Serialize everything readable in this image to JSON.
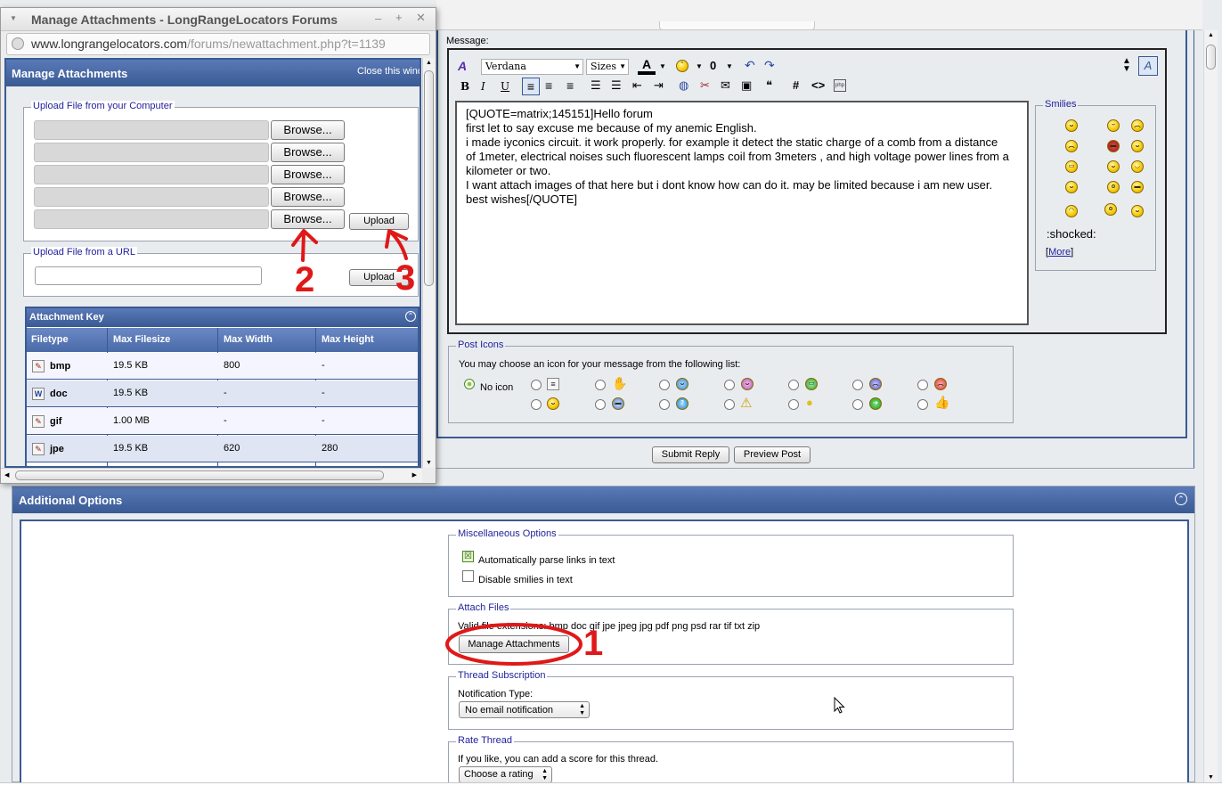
{
  "popup": {
    "window_title": "Manage Attachments - LongRangeLocators Forums",
    "url_host": "www.longrangelocators.com",
    "url_path": "/forums/newattachment.php?t=1139",
    "panel_title": "Manage Attachments",
    "close_link": "Close this wind",
    "upload_computer_legend": "Upload File from your Computer",
    "browse_label": "Browse...",
    "upload_label": "Upload",
    "upload_url_legend": "Upload File from a URL",
    "attachment_key_title": "Attachment Key",
    "columns": [
      "Filetype",
      "Max Filesize",
      "Max Width",
      "Max Height"
    ],
    "rows": [
      {
        "type": "bmp",
        "size": "19.5 KB",
        "width": "800",
        "height": "-"
      },
      {
        "type": "doc",
        "size": "19.5 KB",
        "width": "-",
        "height": "-"
      },
      {
        "type": "gif",
        "size": "1.00 MB",
        "width": "-",
        "height": "-"
      },
      {
        "type": "jpe",
        "size": "19.5 KB",
        "width": "620",
        "height": "280"
      }
    ]
  },
  "editor": {
    "message_label": "Message:",
    "font_name": "Verdana",
    "font_size": "Sizes",
    "text_lines": [
      "[QUOTE=matrix;145151]Hello forum",
      "first let to say excuse me because of my anemic English.",
      "i made iyconics circuit. it work properly. for example it detect the static charge of a comb from a distance",
      "of 1meter, electrical noises such fluorescent lamps coil from 3meters , and high voltage power lines from a",
      "kilometer or two.",
      "I want attach images of that here but i dont know how can do it. may be limited because i am new user.",
      "best wishes[/QUOTE]"
    ],
    "smilies_legend": "Smilies",
    "smilie_label": ":shocked:",
    "more_link": "More"
  },
  "post_icons": {
    "legend": "Post Icons",
    "instruction": "You may choose an icon for your message from the following list:",
    "no_icon_label": "No icon"
  },
  "buttons": {
    "submit": "Submit Reply",
    "preview": "Preview Post"
  },
  "additional": {
    "title": "Additional Options",
    "misc_legend": "Miscellaneous Options",
    "parse_links": "Automatically parse links in text",
    "parse_links_checked": true,
    "disable_smilies": "Disable smilies in text",
    "disable_smilies_checked": false,
    "attach_legend": "Attach Files",
    "valid_ext": "Valid file extensions: bmp doc gif jpe jpeg jpg pdf png psd rar tif txt zip",
    "manage_btn": "Manage Attachments",
    "subscription_legend": "Thread Subscription",
    "notification_label": "Notification Type:",
    "notification_value": "No email notification",
    "rate_legend": "Rate Thread",
    "rate_text": "If you like, you can add a score for this thread.",
    "rate_value": "Choose a rating"
  },
  "annotations": [
    "1",
    "2",
    "3"
  ],
  "colors": {
    "panel_header": "#3a5a94",
    "annotation_red": "#e01818",
    "legend_blue": "#22229c"
  }
}
